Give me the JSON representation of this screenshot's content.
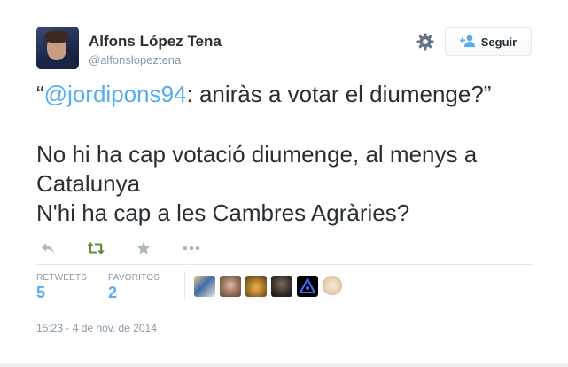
{
  "author": {
    "display_name": "Alfons López Tena",
    "handle": "@alfonslopeztena"
  },
  "header": {
    "settings_icon": "gear-icon",
    "follow_icon": "follow-person-plus-icon",
    "follow_label": "Seguir"
  },
  "tweet": {
    "quote_open": "“",
    "mention": "@jordipons94",
    "quote_rest": ": aniràs a votar el diumenge?”",
    "line2": "No hi ha cap votació diumenge, al menys a",
    "line3": "Catalunya",
    "line4": "N'hi ha cap a les Cambres Agràries?"
  },
  "actions": [
    {
      "icon": "reply-icon",
      "color": "#aab8c2"
    },
    {
      "icon": "retweet-icon",
      "color": "#5c913b"
    },
    {
      "icon": "favorite-star-icon",
      "color": "#aab8c2"
    },
    {
      "icon": "more-icon",
      "color": "#aab8c2"
    }
  ],
  "stats": {
    "retweets_label": "RETWEETS",
    "retweets_value": "5",
    "favorites_label": "FAVORITOS",
    "favorites_value": "2"
  },
  "timestamp": "15:23 - 4 de nov. de 2014",
  "colors": {
    "link": "#55acee",
    "text": "#292f33",
    "muted": "#8899a6",
    "border": "#e1e8ed"
  }
}
